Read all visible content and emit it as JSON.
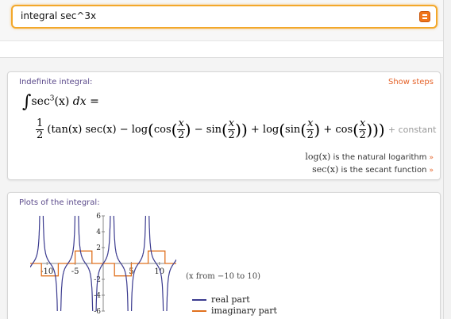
{
  "search": {
    "value": "integral sec^3x"
  },
  "pods": {
    "integral": {
      "title": "Indefinite integral:",
      "show_steps": "Show steps",
      "line1": {
        "integrand": "sec",
        "power": "3",
        "arg": "(x)",
        "dx": " dx ="
      },
      "line2": {
        "half": {
          "num": "1",
          "den": "2"
        },
        "text_a": "(tan(x) sec(x) − log",
        "text_b": "cos",
        "text_c": "− sin",
        "text_d": "+ log",
        "text_e": "sin",
        "text_f": "+ cos",
        "x_over_2": {
          "num": "x",
          "den": "2"
        },
        "constant": "+ constant"
      },
      "notes": [
        {
          "math": "log(x)",
          "text": "is the natural logarithm"
        },
        {
          "math": "sec(x)",
          "text": "is the secant function"
        }
      ]
    },
    "plot": {
      "title": "Plots of the integral:",
      "range_caption": "(x from −10 to 10)",
      "legend": [
        {
          "name": "real part",
          "color": "#3b3b8f"
        },
        {
          "name": "imaginary part",
          "color": "#e0711f"
        }
      ]
    }
  },
  "chart_data": {
    "type": "line",
    "xlim": [
      -13,
      13
    ],
    "ylim": [
      -6,
      6
    ],
    "xticks": [
      -10,
      -5,
      5,
      10
    ],
    "xtick_labels": [
      "-10",
      "-5",
      "5",
      "10"
    ],
    "yticks": [
      -6,
      -4,
      -2,
      2,
      4,
      6
    ],
    "ytick_labels": [
      "-6",
      "-4",
      "-2",
      "2",
      "4",
      "6"
    ],
    "series": [
      {
        "name": "real part",
        "color": "#3b3b8f",
        "function": "0.5*(tan(x)*sec(x) + ln|sec(x)+tan(x)|)"
      },
      {
        "name": "imaginary part",
        "color": "#e0711f",
        "x": [
          -13,
          -11,
          -11,
          -8,
          -8,
          -5,
          -5,
          -2,
          -2,
          2,
          2,
          5,
          5,
          8,
          8,
          11,
          11,
          13
        ],
        "y": [
          0,
          0,
          -1.57,
          -1.57,
          0,
          0,
          1.57,
          1.57,
          0,
          0,
          -1.57,
          -1.57,
          0,
          0,
          1.57,
          1.57,
          0,
          0
        ]
      }
    ]
  }
}
